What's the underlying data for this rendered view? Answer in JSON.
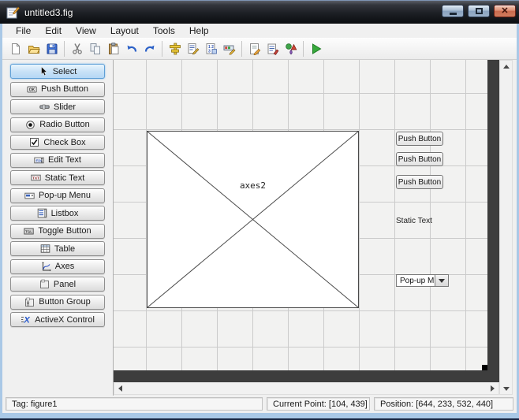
{
  "window": {
    "title": "untitled3.fig",
    "controls": [
      "minimize-icon",
      "maximize-icon",
      "close-icon"
    ]
  },
  "menu": {
    "items": [
      "File",
      "Edit",
      "View",
      "Layout",
      "Tools",
      "Help"
    ]
  },
  "toolbar": {
    "buttons": [
      "New",
      "Open",
      "Save",
      "Cut",
      "Copy",
      "Paste",
      "Undo",
      "Redo",
      "Align Objects",
      "Menu Editor",
      "Tab Order Editor",
      "Toolbar Editor",
      "Editor",
      "Property Inspector",
      "Object Browser",
      "Run"
    ]
  },
  "palette": {
    "items": [
      {
        "label": "Select",
        "icon": "cursor-icon",
        "selected": true
      },
      {
        "label": "Push Button",
        "icon": "pushbutton-icon"
      },
      {
        "label": "Slider",
        "icon": "slider-icon"
      },
      {
        "label": "Radio Button",
        "icon": "radiobutton-icon"
      },
      {
        "label": "Check Box",
        "icon": "checkbox-icon"
      },
      {
        "label": "Edit Text",
        "icon": "edittext-icon"
      },
      {
        "label": "Static Text",
        "icon": "statictext-icon"
      },
      {
        "label": "Pop-up Menu",
        "icon": "popupmenu-icon"
      },
      {
        "label": "Listbox",
        "icon": "listbox-icon"
      },
      {
        "label": "Toggle Button",
        "icon": "togglebutton-icon"
      },
      {
        "label": "Table",
        "icon": "table-icon"
      },
      {
        "label": "Axes",
        "icon": "axes-icon"
      },
      {
        "label": "Panel",
        "icon": "panel-icon"
      },
      {
        "label": "Button Group",
        "icon": "buttongroup-icon"
      },
      {
        "label": "ActiveX Control",
        "icon": "activex-icon"
      }
    ]
  },
  "canvas": {
    "axes_label": "axes2",
    "push_buttons": [
      "Push Button",
      "Push Button",
      "Push Button"
    ],
    "static_text": "Static Text",
    "popup_menu": "Pop-up M..."
  },
  "statusbar": {
    "tag": "Tag: figure1",
    "current_point": "Current Point:  [104, 439]",
    "position": "Position: [644, 233, 532, 440]"
  },
  "colors": {
    "selected_palette": "#bcddf5",
    "titlebar_dark": "#1c1f24",
    "run_green": "#37a93c",
    "close_red": "#c96a4d",
    "grid_line": "#cbcbcb",
    "outside_figure": "#3d3d3d",
    "frame_blue": "#a9c8e6"
  }
}
